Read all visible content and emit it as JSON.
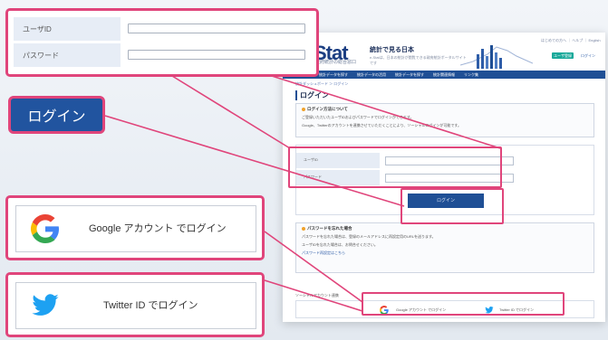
{
  "callout_form": {
    "user_id_label": "ユーザID",
    "password_label": "パスワード"
  },
  "login_button": {
    "label": "ログイン"
  },
  "social_login": {
    "google_label": "Google アカウント でログイン",
    "twitter_label": "Twitter ID でログイン"
  },
  "site": {
    "logo_text": "Stat",
    "logo_sub": "政府統計の総合窓口",
    "title": "統計で見る日本",
    "description": "e-Statは、日本の統計が閲覧できる政府統計ポータルサイトです",
    "header_links": "はじめての方へ ｜ ヘルプ ｜ English",
    "header_button_new": "ユーザ登録",
    "header_button_login": "ログイン",
    "nav_items": [
      "トップ",
      "統計データを探す",
      "統計データの活用",
      "統計データを探す",
      "統計関連情報",
      "リンク集"
    ],
    "breadcrumb": "統計ダッシュボード ＞ ログイン",
    "page_heading": "ログイン",
    "notice_title": "ログイン方法について",
    "notice_lines": [
      "ご登録いただいたユーザIDおよびパスワードでログインができます。",
      "Google、Twitterのアカウントを連携させていただくことにより、ソーシャルログインが可能です。"
    ],
    "mini_user_label": "ユーザID",
    "mini_password_label": "パスワード",
    "mini_login_label": "ログイン",
    "notice2_title": "パスワードを忘れた場合",
    "notice2_lines": [
      "パスワードを忘れた場合は、登録のメールアドレスに再設定用のURLを送ります。",
      "ユーザIDを忘れた場合は、お問合せください。",
      "パスワード再設定はこちら"
    ],
    "social_heading": "ソーシャルアカウント連携",
    "mini_google_label": "Google アカウント でログイン",
    "mini_twitter_label": "Twitter ID でログイン"
  },
  "colors": {
    "highlight": "#e0457b",
    "primary_blue": "#21549f",
    "google_blue": "#4285f4",
    "twitter_blue": "#1da1f2"
  }
}
